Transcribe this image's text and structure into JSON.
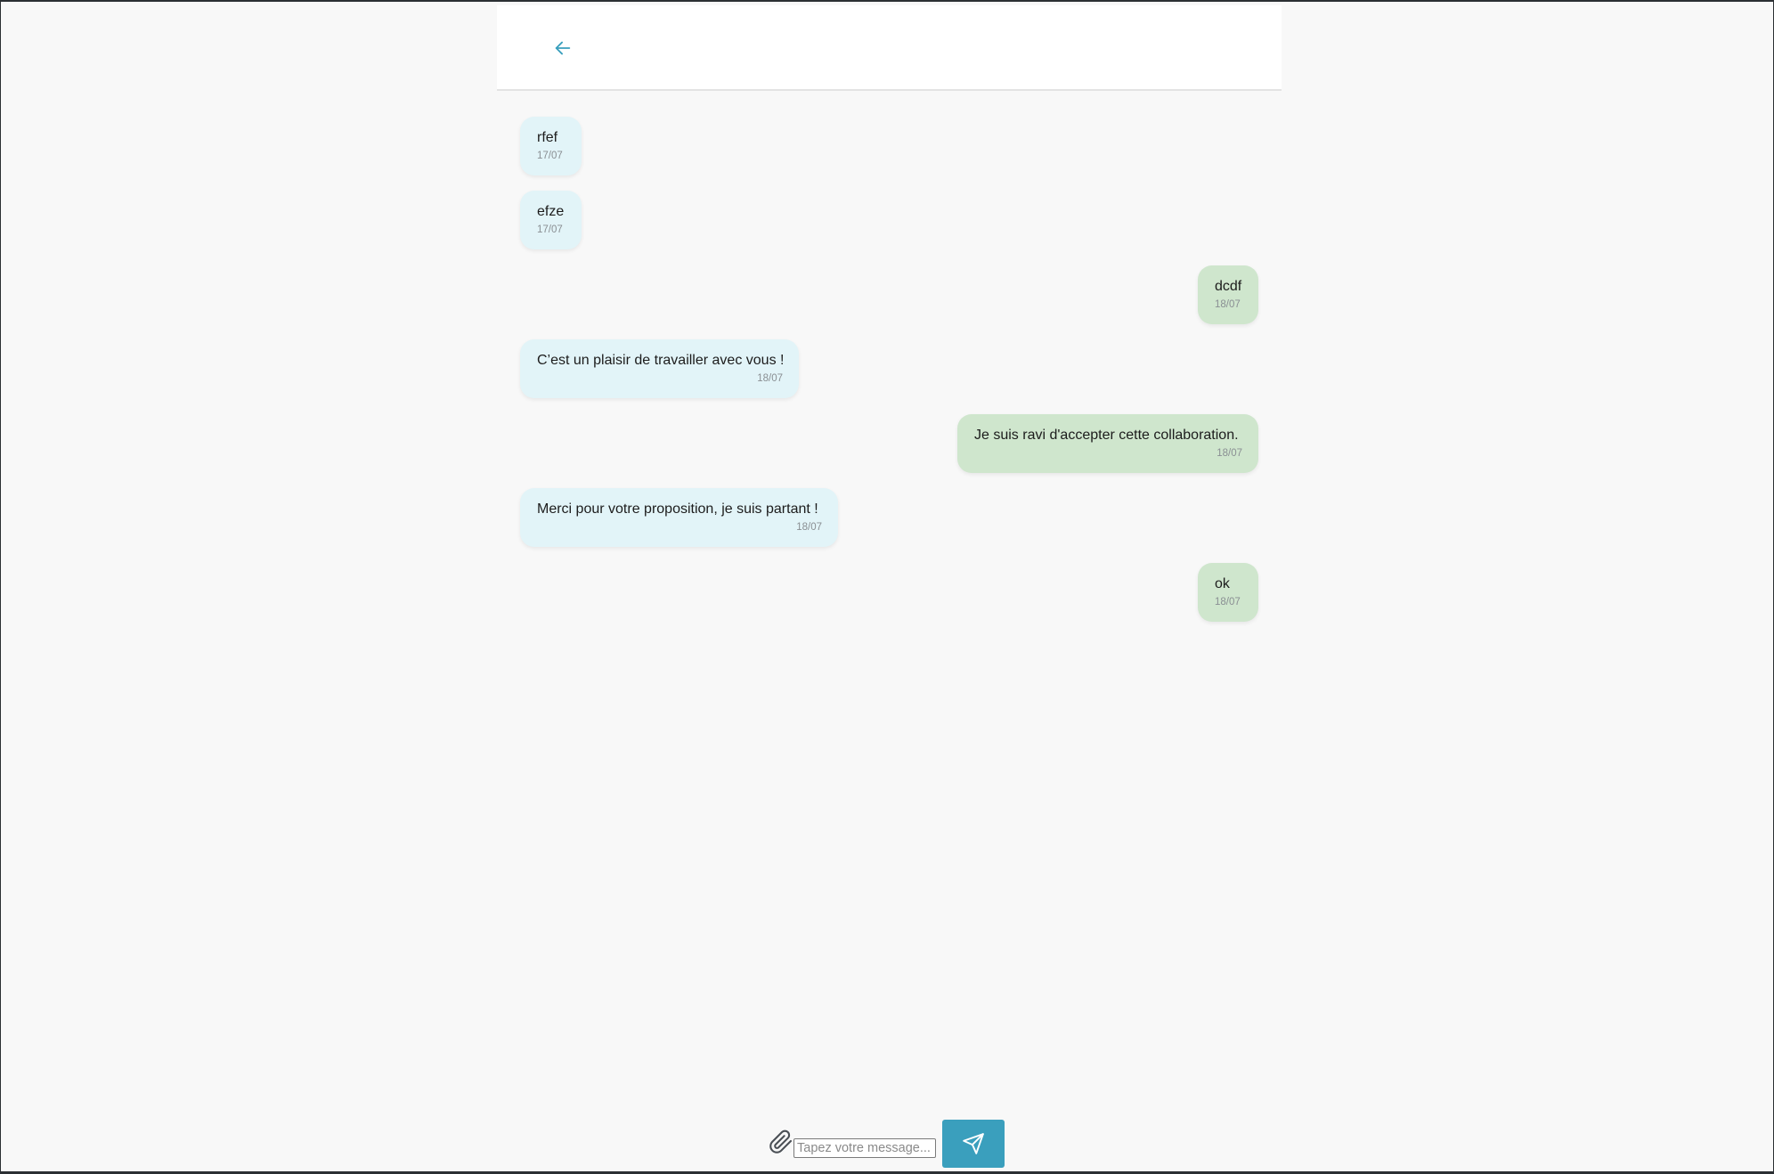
{
  "header": {
    "back_icon": "arrow-left-icon"
  },
  "colors": {
    "accent": "#3a9fbd",
    "received_bubble": "#e2f4f8",
    "sent_bubble": "#cfe6cd",
    "background": "#f8f8f8"
  },
  "messages": [
    {
      "direction": "received",
      "text": "rfef",
      "time": "17/07"
    },
    {
      "direction": "received",
      "text": "efze",
      "time": "17/07"
    },
    {
      "direction": "sent",
      "text": "dcdf",
      "time": "18/07"
    },
    {
      "direction": "received",
      "text": "C’est un plaisir de travailler avec vous !",
      "time": "18/07"
    },
    {
      "direction": "sent",
      "text": "Je suis ravi d'accepter cette collaboration.",
      "time": "18/07"
    },
    {
      "direction": "received",
      "text": "Merci pour votre proposition, je suis partant !",
      "time": "18/07"
    },
    {
      "direction": "sent",
      "text": "ok",
      "time": "18/07"
    }
  ],
  "composer": {
    "attach_icon": "paperclip-icon",
    "placeholder": "Tapez votre message...",
    "value": "",
    "send_icon": "send-icon"
  }
}
